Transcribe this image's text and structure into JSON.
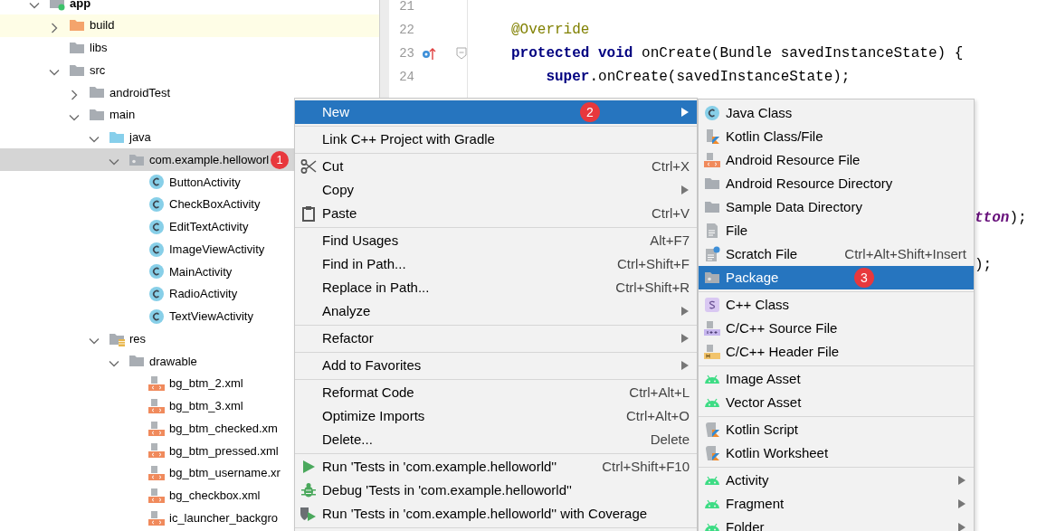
{
  "project_tree": [
    {
      "label": "app",
      "kind": "module",
      "expanded": true,
      "selected": false,
      "children": [
        {
          "label": "build",
          "kind": "folder-excluded",
          "expanded": false,
          "selected": false,
          "highlighted": true
        },
        {
          "label": "libs",
          "kind": "folder",
          "selected": false
        },
        {
          "label": "src",
          "kind": "folder",
          "expanded": true,
          "selected": false,
          "children": [
            {
              "label": "androidTest",
              "kind": "folder",
              "expanded": false,
              "selected": false
            },
            {
              "label": "main",
              "kind": "folder",
              "expanded": true,
              "selected": false,
              "children": [
                {
                  "label": "java",
                  "kind": "folder-source",
                  "expanded": true,
                  "selected": false,
                  "children": [
                    {
                      "label": "com.example.helloworl",
                      "kind": "package",
                      "expanded": true,
                      "selected": true,
                      "badge": "1",
                      "children": [
                        {
                          "label": "ButtonActivity",
                          "kind": "class",
                          "selected": false
                        },
                        {
                          "label": "CheckBoxActivity",
                          "kind": "class",
                          "selected": false
                        },
                        {
                          "label": "EditTextActivity",
                          "kind": "class",
                          "selected": false
                        },
                        {
                          "label": "ImageViewActivity",
                          "kind": "class",
                          "selected": false
                        },
                        {
                          "label": "MainActivity",
                          "kind": "class",
                          "selected": false
                        },
                        {
                          "label": "RadioActivity",
                          "kind": "class",
                          "selected": false
                        },
                        {
                          "label": "TextViewActivity",
                          "kind": "class",
                          "selected": false
                        }
                      ]
                    }
                  ]
                },
                {
                  "label": "res",
                  "kind": "res",
                  "expanded": true,
                  "selected": false,
                  "children": [
                    {
                      "label": "drawable",
                      "kind": "folder",
                      "expanded": true,
                      "selected": false,
                      "children": [
                        {
                          "label": "bg_btm_2.xml",
                          "kind": "xml",
                          "selected": false
                        },
                        {
                          "label": "bg_btm_3.xml",
                          "kind": "xml",
                          "selected": false
                        },
                        {
                          "label": "bg_btm_checked.xm",
                          "kind": "xml",
                          "selected": false
                        },
                        {
                          "label": "bg_btm_pressed.xml",
                          "kind": "xml",
                          "selected": false
                        },
                        {
                          "label": "bg_btm_username.xr",
                          "kind": "xml",
                          "selected": false
                        },
                        {
                          "label": "bg_checkbox.xml",
                          "kind": "xml",
                          "selected": false
                        },
                        {
                          "label": "ic_launcher_backgro",
                          "kind": "xml",
                          "selected": false
                        }
                      ]
                    }
                  ]
                }
              ]
            }
          ]
        }
      ]
    }
  ],
  "editor": {
    "lines": [
      {
        "kind": "line",
        "number": "21"
      },
      {
        "kind": "line",
        "number": "22",
        "tokens": [
          {
            "text": "@Override",
            "kind": "annotation"
          }
        ]
      },
      {
        "kind": "override-line",
        "number": "23",
        "tokens": [
          {
            "text": "protected void ",
            "kind": "keyword"
          },
          {
            "text": "onCreate(Bundle savedInstanceState) {",
            "kind": "plain"
          }
        ]
      },
      {
        "kind": "line",
        "number": "24",
        "tokens": [
          {
            "text": "    super",
            "kind": "keyword"
          },
          {
            "text": ".onCreate(savedInstanceState);",
            "kind": "plain"
          }
        ]
      },
      {
        "kind": "clipped"
      },
      {
        "kind": "clipped"
      },
      {
        "kind": "clipped"
      },
      {
        "kind": "clipped"
      },
      {
        "kind": "clipped"
      },
      {
        "kind": "clipped",
        "tokens": [
          {
            "text": "tton",
            "kind": "field"
          },
          {
            "text": ");",
            "kind": "plain"
          }
        ]
      },
      {
        "kind": "clipped"
      },
      {
        "kind": "clipped",
        "tokens": [
          {
            "text": ");",
            "kind": "plain"
          }
        ]
      }
    ]
  },
  "context_menu": [
    {
      "kind": "item",
      "label": "New",
      "has_submenu": true,
      "selected": true,
      "badge": "2"
    },
    {
      "kind": "separator"
    },
    {
      "kind": "item",
      "label": "Link C++ Project with Gradle",
      "has_submenu": false,
      "selected": false
    },
    {
      "kind": "separator"
    },
    {
      "kind": "cut",
      "label": "Cut",
      "shortcut": "Ctrl+X",
      "has_submenu": false,
      "selected": false
    },
    {
      "kind": "item",
      "label": "Copy",
      "has_submenu": true,
      "selected": false
    },
    {
      "kind": "paste",
      "label": "Paste",
      "shortcut": "Ctrl+V",
      "has_submenu": false,
      "selected": false
    },
    {
      "kind": "separator"
    },
    {
      "kind": "item",
      "label": "Find Usages",
      "shortcut": "Alt+F7",
      "has_submenu": false,
      "selected": false
    },
    {
      "kind": "item",
      "label": "Find in Path...",
      "shortcut": "Ctrl+Shift+F",
      "has_submenu": false,
      "selected": false
    },
    {
      "kind": "item",
      "label": "Replace in Path...",
      "shortcut": "Ctrl+Shift+R",
      "has_submenu": false,
      "selected": false
    },
    {
      "kind": "item",
      "label": "Analyze",
      "has_submenu": true,
      "selected": false
    },
    {
      "kind": "separator"
    },
    {
      "kind": "item",
      "label": "Refactor",
      "has_submenu": true,
      "selected": false
    },
    {
      "kind": "separator"
    },
    {
      "kind": "item",
      "label": "Add to Favorites",
      "has_submenu": true,
      "selected": false
    },
    {
      "kind": "separator"
    },
    {
      "kind": "item",
      "label": "Reformat Code",
      "shortcut": "Ctrl+Alt+L",
      "has_submenu": false,
      "selected": false
    },
    {
      "kind": "item",
      "label": "Optimize Imports",
      "shortcut": "Ctrl+Alt+O",
      "has_submenu": false,
      "selected": false
    },
    {
      "kind": "item",
      "label": "Delete...",
      "shortcut": "Delete",
      "has_submenu": false,
      "selected": false
    },
    {
      "kind": "separator"
    },
    {
      "kind": "run",
      "label": "Run 'Tests in 'com.example.helloworld''",
      "shortcut": "Ctrl+Shift+F10",
      "has_submenu": false,
      "selected": false
    },
    {
      "kind": "debug",
      "label": "Debug 'Tests in 'com.example.helloworld''",
      "has_submenu": false,
      "selected": false
    },
    {
      "kind": "coverage",
      "label": "Run 'Tests in 'com.example.helloworld'' with Coverage",
      "has_submenu": false,
      "selected": false
    },
    {
      "kind": "separator"
    }
  ],
  "new_submenu": [
    {
      "kind": "class",
      "label": "Java Class",
      "has_submenu": false,
      "selected": false
    },
    {
      "kind": "kotlin-file",
      "label": "Kotlin Class/File",
      "has_submenu": false,
      "selected": false
    },
    {
      "kind": "xml",
      "label": "Android Resource File",
      "has_submenu": false,
      "selected": false
    },
    {
      "kind": "folder",
      "label": "Android Resource Directory",
      "has_submenu": false,
      "selected": false
    },
    {
      "kind": "folder",
      "label": "Sample Data Directory",
      "has_submenu": false,
      "selected": false
    },
    {
      "kind": "file",
      "label": "File",
      "has_submenu": false,
      "selected": false
    },
    {
      "kind": "scratch",
      "label": "Scratch File",
      "shortcut": "Ctrl+Alt+Shift+Insert",
      "has_submenu": false,
      "selected": false
    },
    {
      "kind": "package",
      "label": "Package",
      "has_submenu": false,
      "selected": true,
      "badge": "3"
    },
    {
      "kind": "separator"
    },
    {
      "kind": "cpp-class",
      "label": "C++ Class",
      "has_submenu": false,
      "selected": false
    },
    {
      "kind": "cpp-source",
      "label": "C/C++ Source File",
      "has_submenu": false,
      "selected": false
    },
    {
      "kind": "cpp-header",
      "label": "C/C++ Header File",
      "has_submenu": false,
      "selected": false
    },
    {
      "kind": "separator"
    },
    {
      "kind": "android",
      "label": "Image Asset",
      "has_submenu": false,
      "selected": false
    },
    {
      "kind": "android",
      "label": "Vector Asset",
      "has_submenu": false,
      "selected": false
    },
    {
      "kind": "separator"
    },
    {
      "kind": "kotlin-script",
      "label": "Kotlin Script",
      "has_submenu": false,
      "selected": false
    },
    {
      "kind": "kotlin-script",
      "label": "Kotlin Worksheet",
      "has_submenu": false,
      "selected": false
    },
    {
      "kind": "separator"
    },
    {
      "kind": "android",
      "label": "Activity",
      "has_submenu": true,
      "selected": false
    },
    {
      "kind": "android",
      "label": "Fragment",
      "has_submenu": true,
      "selected": false
    },
    {
      "kind": "android",
      "label": "Folder",
      "has_submenu": true,
      "selected": false
    }
  ]
}
